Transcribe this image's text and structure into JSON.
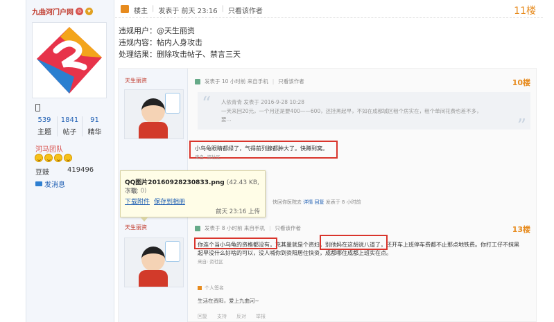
{
  "sidebar": {
    "username": "九曲河门户网",
    "stats": [
      {
        "value": "539",
        "label": "主题"
      },
      {
        "value": "1841",
        "label": "帖子"
      },
      {
        "value": "91",
        "label": "精华"
      }
    ],
    "group": "河马团队",
    "coin_label": "豆豉",
    "coin_value": "419496",
    "message_link": "发消息"
  },
  "post": {
    "role": "楼主",
    "posted": "发表于 前天 23:16",
    "only_author": "只看该作者",
    "floor": "11楼",
    "lines": [
      "违规用户：@天生丽资",
      "违规内容：帖内人身攻击",
      "处理结果：删除攻击帖子、禁言三天"
    ]
  },
  "embed": {
    "post1": {
      "name": "天生丽资",
      "header": "发表于 10 小时前 来自手机",
      "only_author": "只看该作者",
      "floor": "10楼",
      "quote_user": "人依青青 发表于 2016-9-28 10:28",
      "quote_text": "一天来回20元，一个月还是要400——600，还挂黑起早，不如在成都城区租个房实在，租个单间花费也差不多，要...",
      "reply": "小鸟龟眼睛都绿了，气得前列腺都肿大了。快蹲到窝。",
      "from": "来自: 资社区",
      "links": "快回你医院去",
      "link_detail": "详情",
      "link_reply": "回复",
      "link_time": "发表于 8 小时前"
    },
    "post2": {
      "name": "天生丽资",
      "header": "发表于 8 小时前 来自手机",
      "only_author": "只看该作者",
      "floor": "13楼",
      "seg1": "你连个当小乌龟的资格都没有",
      "seg2": "，充其量就是个资妇",
      "seg3": "，别他妈在这胡说八道了",
      "seg4": "，还开车上班停车费都不止那点地铁费。你打工仔不抹黑",
      "line2": "起早没什么好啥的可以，没人喊你到资阳居住快资，成都哪住成都上班实在点。",
      "from": "来自: 资社区",
      "sig_title": "个人签名",
      "sig_text": "生活在资阳，爱上九曲河~",
      "actions": [
        "回复",
        "支持",
        "反对",
        "举报"
      ]
    }
  },
  "tooltip": {
    "filename": "QQ图片20160928230833.png",
    "size": "(42.43 KB, 下载",
    "count": "次数: 0)",
    "download": "下载附件",
    "save": "保存到相册",
    "time": "前天 23:16 上传"
  }
}
